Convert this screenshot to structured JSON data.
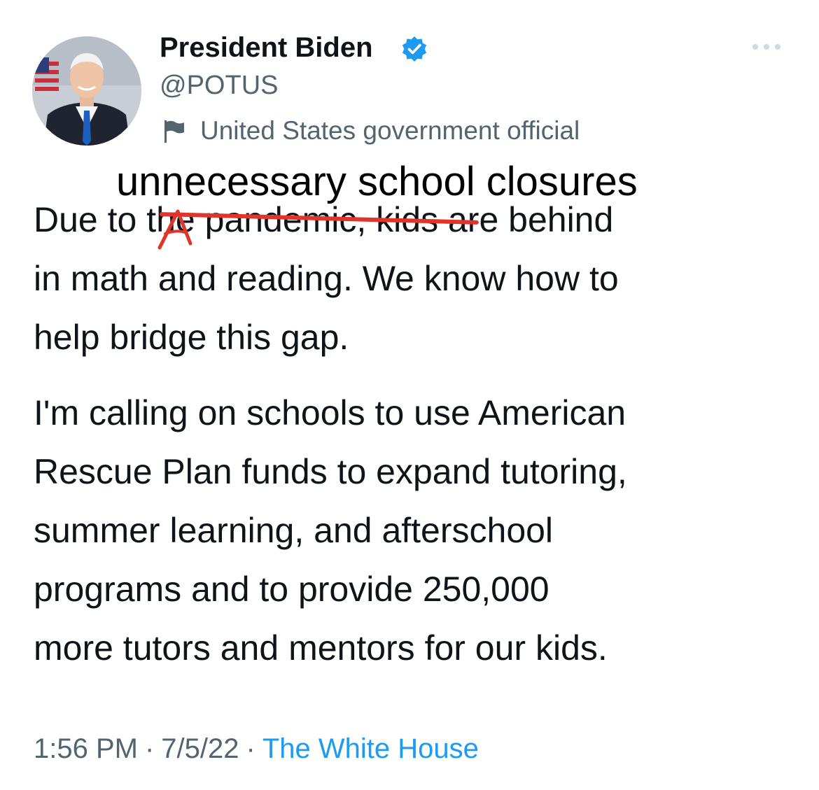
{
  "author": {
    "display_name": "President Biden",
    "handle": "@POTUS",
    "affiliation_label": "United States government official",
    "avatar_icon": "portrait-avatar",
    "verified_icon": "verified-badge-icon",
    "verified_color": "#1d9bf0"
  },
  "annotation": {
    "overwrite_text": "unnecessary school closures",
    "strike_color": "#e0352b"
  },
  "tweet": {
    "paragraph_1": "Due to the pandemic, kids are behind\nin math and reading. We know how to\nhelp bridge this gap.",
    "paragraph_2": "I'm calling on schools to use American\nRescue Plan funds to expand tutoring,\nsummer learning, and afterschool\nprograms and to provide 250,000\nmore tutors and mentors for our kids."
  },
  "footer": {
    "time": "1:56 PM",
    "date": "7/5/22",
    "source": "The White House",
    "separator": "·",
    "link_color": "#1d9bf0"
  }
}
